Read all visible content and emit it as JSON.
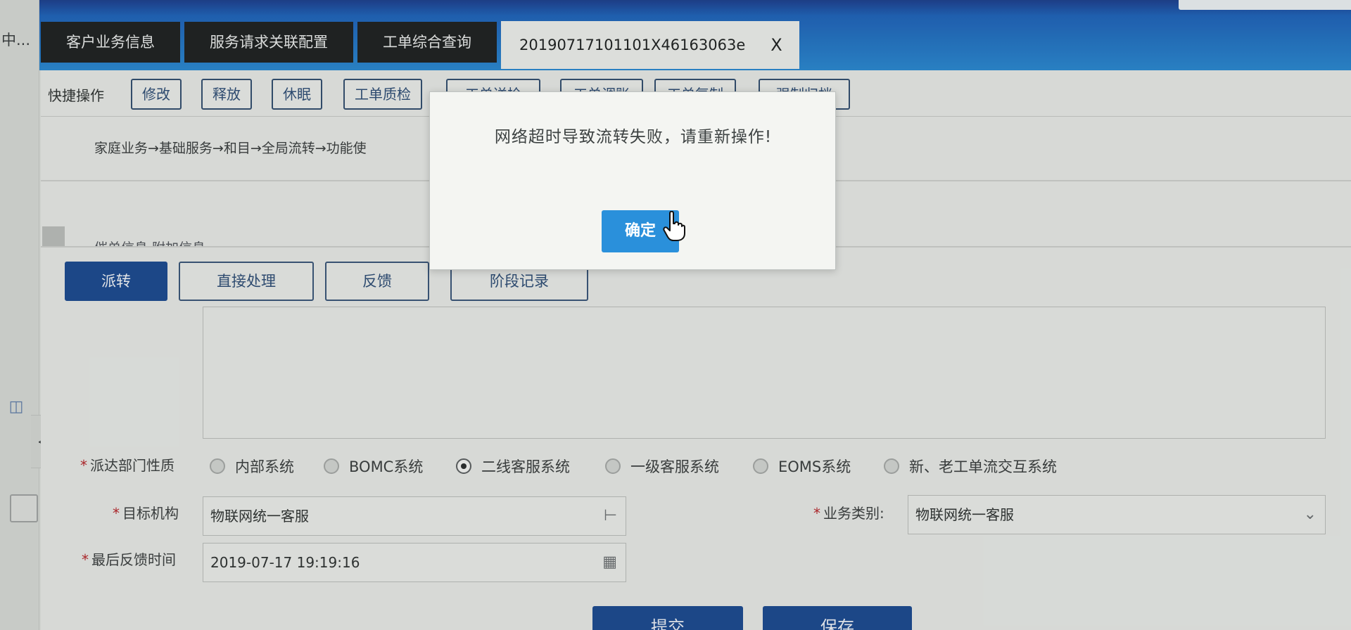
{
  "left_cut_text": "中...",
  "tabs": [
    {
      "label": "客户业务信息"
    },
    {
      "label": "服务请求关联配置"
    },
    {
      "label": "工单综合查询"
    }
  ],
  "active_tab": {
    "label": "20190717101101X46163063e",
    "close": "X"
  },
  "quick_ops": {
    "label": "快捷操作",
    "buttons": [
      "修改",
      "释放",
      "休眠",
      "工单质检",
      "工单送检",
      "工单调账",
      "工单复制",
      "强制归档"
    ]
  },
  "breadcrumb": "家庭业务→基础服务→和目→全局流转→功能使",
  "sub_section_cut": "催单信息 附加信息",
  "actions": [
    "派转",
    "直接处理",
    "反馈",
    "阶段记录"
  ],
  "form": {
    "dept_type_label": "派达部门性质",
    "dept_options": [
      {
        "label": "内部系统",
        "checked": false
      },
      {
        "label": "BOMC系统",
        "checked": false
      },
      {
        "label": "二线客服系统",
        "checked": true
      },
      {
        "label": "一级客服系统",
        "checked": false
      },
      {
        "label": "EOMS系统",
        "checked": false
      },
      {
        "label": "新、老工单流交互系统",
        "checked": false
      }
    ],
    "target_org_label": "目标机构",
    "target_org_value": "物联网统一客服",
    "biz_type_label": "业务类别:",
    "biz_type_value": "物联网统一客服",
    "last_feedback_label": "最后反馈时间",
    "last_feedback_value": "2019-07-17 19:19:16",
    "submit_label": "提交",
    "save_label": "保存"
  },
  "modal": {
    "message": "网络超时导致流转失败，请重新操作!",
    "ok_label": "确定"
  },
  "left_toggle": "<>",
  "colors": {
    "brand_blue": "#1c4a8e",
    "modal_ok": "#2a90db",
    "required": "#b3262a"
  }
}
